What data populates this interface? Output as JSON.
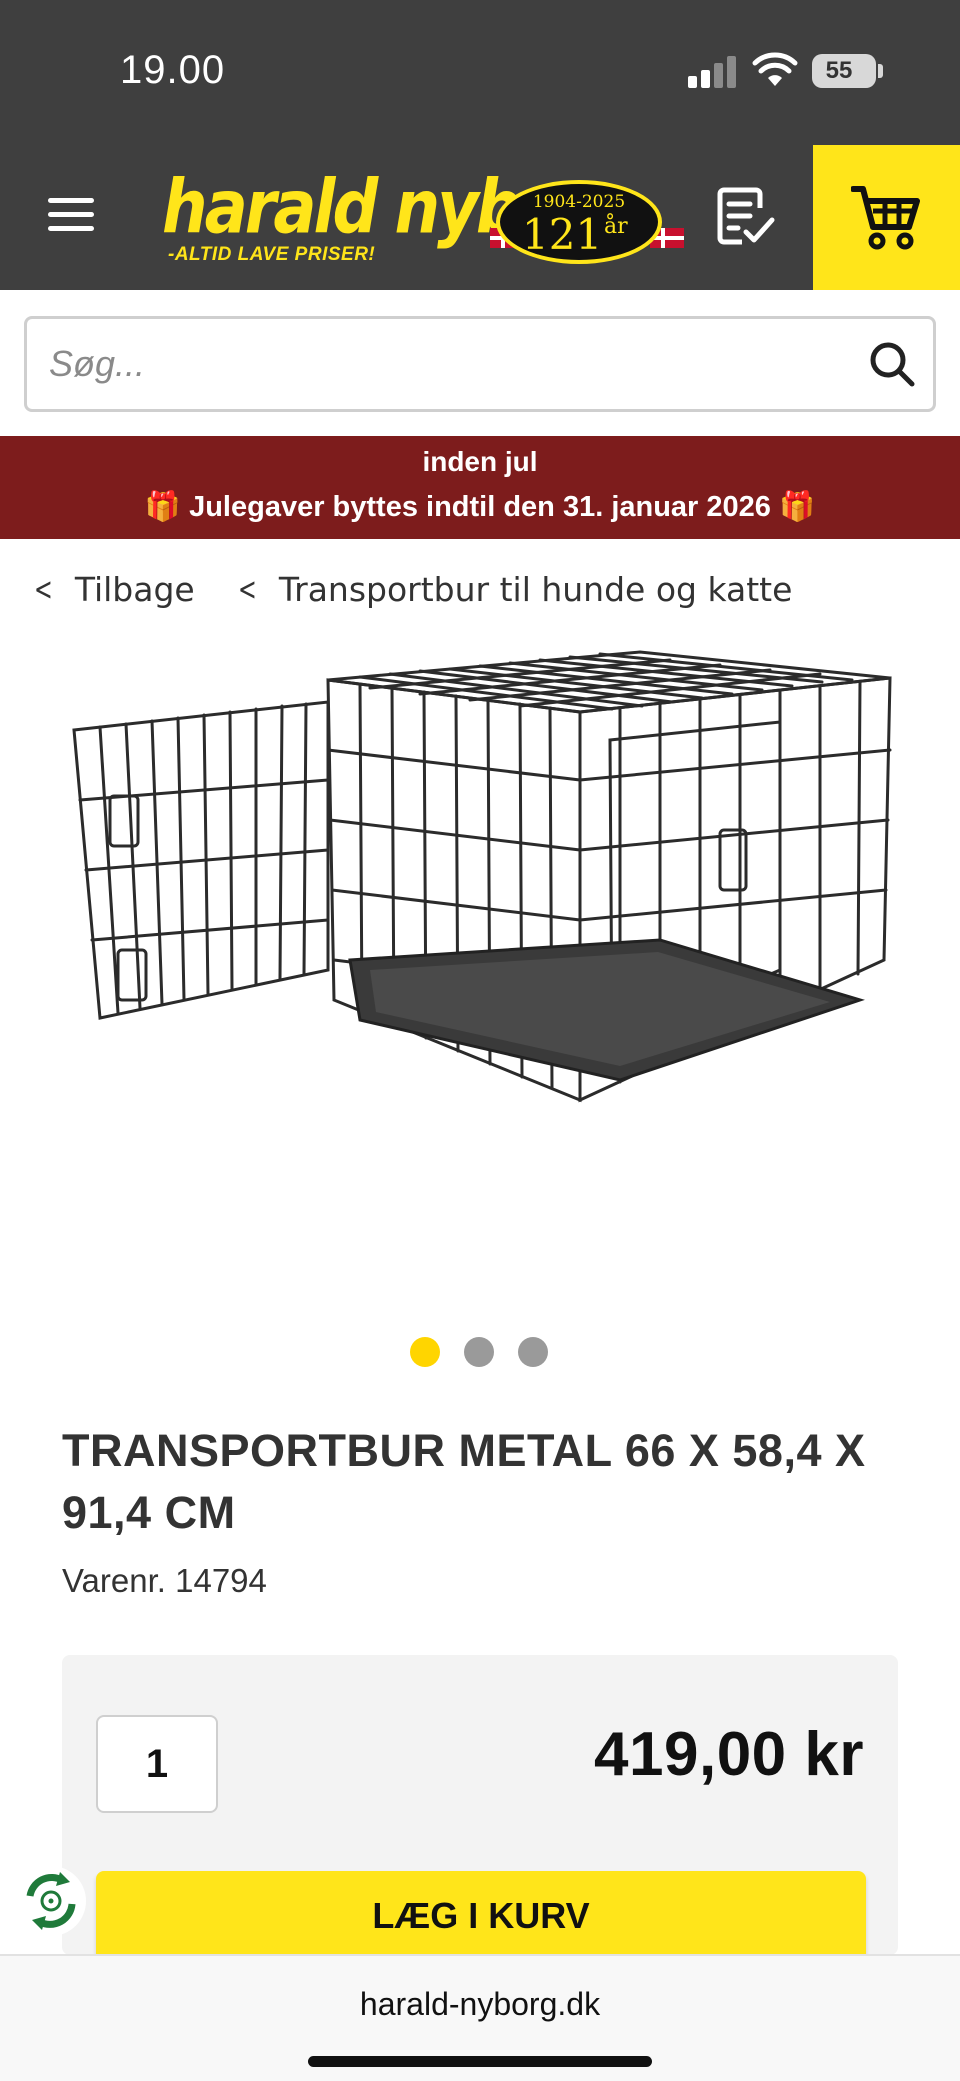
{
  "status_bar": {
    "time": "19.00",
    "battery": "55",
    "signal_icon": "cellular-signal-icon",
    "wifi_icon": "wifi-icon"
  },
  "header": {
    "menu_icon": "hamburger-menu-icon",
    "logo": {
      "name": "harald nyborg",
      "tagline": "-ALTID LAVE PRISER!",
      "anniversary_years": "1904-2025",
      "anniversary_number": "121",
      "anniversary_suffix": "år"
    },
    "list_icon": "shopping-list-icon",
    "cart_icon": "shopping-cart-icon",
    "brand_color": "#ffe51a",
    "background_color": "#3f3f3f"
  },
  "search": {
    "placeholder": "Søg...",
    "value": ""
  },
  "promo": {
    "line1": "inden jul",
    "line2": "🎁 Julegaver byttes indtil den 31. januar 2026 🎁",
    "background_color": "#7d1c1c"
  },
  "breadcrumbs": {
    "back": "Tilbage",
    "category": "Transportbur til hunde og katte"
  },
  "gallery": {
    "image_count": 3,
    "active_index": 0
  },
  "product": {
    "title": "TRANSPORTBUR METAL 66 X 58,4 X 91,4 CM",
    "sku": "Varenr. 14794",
    "quantity": "1",
    "price": "419,00 kr",
    "add_to_cart": "LÆG I KURV"
  },
  "browser": {
    "url": "harald-nyborg.dk"
  }
}
